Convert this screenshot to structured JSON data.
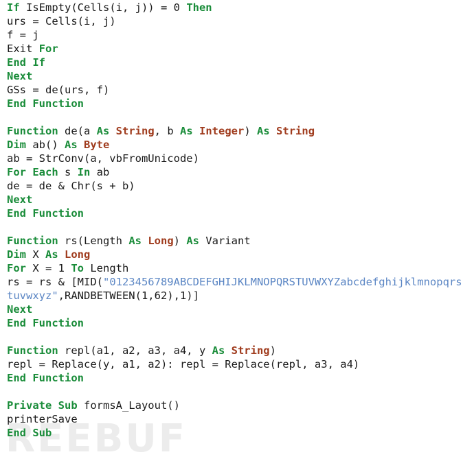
{
  "document": {
    "kind": "vba-source-code-listing",
    "background_color": "#ffffff",
    "watermark": {
      "text": "REEBUF",
      "color": "#ececec"
    },
    "syntax_colors": {
      "keyword": "#198c39",
      "type": "#a03c1e",
      "string": "#5b86c4",
      "plain": "#1a1a1a"
    }
  },
  "code": {
    "lines": [
      {
        "id": "line-1",
        "text": "If IsEmpty(Cells(i, j)) = 0 Then",
        "tokens": [
          {
            "t": "If",
            "c": "kw"
          },
          {
            "t": " IsEmpty(Cells(i, j)) = 0 ",
            "c": "pln"
          },
          {
            "t": "Then",
            "c": "kw"
          }
        ]
      },
      {
        "id": "line-2",
        "text": "urs = Cells(i, j)",
        "tokens": [
          {
            "t": "urs = Cells(i, j)",
            "c": "pln"
          }
        ]
      },
      {
        "id": "line-3",
        "text": "f = j",
        "tokens": [
          {
            "t": "f = j",
            "c": "pln"
          }
        ]
      },
      {
        "id": "line-4",
        "text": "Exit For",
        "tokens": [
          {
            "t": "Exit ",
            "c": "pln"
          },
          {
            "t": "For",
            "c": "kw"
          }
        ]
      },
      {
        "id": "line-5",
        "text": "End If",
        "tokens": [
          {
            "t": "End If",
            "c": "kw"
          }
        ]
      },
      {
        "id": "line-6",
        "text": "Next",
        "tokens": [
          {
            "t": "Next",
            "c": "kw"
          }
        ]
      },
      {
        "id": "line-7",
        "text": "GSs = de(urs, f)",
        "tokens": [
          {
            "t": "GSs = de(urs, f)",
            "c": "pln"
          }
        ]
      },
      {
        "id": "line-8",
        "text": "End Function",
        "tokens": [
          {
            "t": "End Function",
            "c": "kw"
          }
        ]
      },
      {
        "id": "line-9",
        "text": "",
        "tokens": []
      },
      {
        "id": "line-10",
        "text": "Function de(a As String, b As Integer) As String",
        "tokens": [
          {
            "t": "Function",
            "c": "kw"
          },
          {
            "t": " de(a ",
            "c": "pln"
          },
          {
            "t": "As",
            "c": "kw"
          },
          {
            "t": " ",
            "c": "pln"
          },
          {
            "t": "String",
            "c": "typ"
          },
          {
            "t": ", b ",
            "c": "pln"
          },
          {
            "t": "As",
            "c": "kw"
          },
          {
            "t": " ",
            "c": "pln"
          },
          {
            "t": "Integer",
            "c": "typ"
          },
          {
            "t": ") ",
            "c": "pln"
          },
          {
            "t": "As",
            "c": "kw"
          },
          {
            "t": " ",
            "c": "pln"
          },
          {
            "t": "String",
            "c": "typ"
          }
        ]
      },
      {
        "id": "line-11",
        "text": "Dim ab() As Byte",
        "tokens": [
          {
            "t": "Dim",
            "c": "kw"
          },
          {
            "t": " ab() ",
            "c": "pln"
          },
          {
            "t": "As",
            "c": "kw"
          },
          {
            "t": " ",
            "c": "pln"
          },
          {
            "t": "Byte",
            "c": "typ"
          }
        ]
      },
      {
        "id": "line-12",
        "text": "ab = StrConv(a, vbFromUnicode)",
        "tokens": [
          {
            "t": "ab = StrConv(a, vbFromUnicode)",
            "c": "pln"
          }
        ]
      },
      {
        "id": "line-13",
        "text": "For Each s In ab",
        "tokens": [
          {
            "t": "For Each",
            "c": "kw"
          },
          {
            "t": " s ",
            "c": "pln"
          },
          {
            "t": "In",
            "c": "kw"
          },
          {
            "t": " ab",
            "c": "pln"
          }
        ]
      },
      {
        "id": "line-14",
        "text": "de = de & Chr(s + b)",
        "tokens": [
          {
            "t": "de = de & Chr(s + b)",
            "c": "pln"
          }
        ]
      },
      {
        "id": "line-15",
        "text": "Next",
        "tokens": [
          {
            "t": "Next",
            "c": "kw"
          }
        ]
      },
      {
        "id": "line-16",
        "text": "End Function",
        "tokens": [
          {
            "t": "End Function",
            "c": "kw"
          }
        ]
      },
      {
        "id": "line-17",
        "text": "",
        "tokens": []
      },
      {
        "id": "line-18",
        "text": "Function rs(Length As Long) As Variant",
        "tokens": [
          {
            "t": "Function",
            "c": "kw"
          },
          {
            "t": " rs(Length ",
            "c": "pln"
          },
          {
            "t": "As",
            "c": "kw"
          },
          {
            "t": " ",
            "c": "pln"
          },
          {
            "t": "Long",
            "c": "typ"
          },
          {
            "t": ") ",
            "c": "pln"
          },
          {
            "t": "As",
            "c": "kw"
          },
          {
            "t": " Variant",
            "c": "pln"
          }
        ]
      },
      {
        "id": "line-19",
        "text": "Dim X As Long",
        "tokens": [
          {
            "t": "Dim",
            "c": "kw"
          },
          {
            "t": " X ",
            "c": "pln"
          },
          {
            "t": "As",
            "c": "kw"
          },
          {
            "t": " ",
            "c": "pln"
          },
          {
            "t": "Long",
            "c": "typ"
          }
        ]
      },
      {
        "id": "line-20",
        "text": "For X = 1 To Length",
        "tokens": [
          {
            "t": "For",
            "c": "kw"
          },
          {
            "t": " X = 1 ",
            "c": "pln"
          },
          {
            "t": "To",
            "c": "kw"
          },
          {
            "t": " Length",
            "c": "pln"
          }
        ]
      },
      {
        "id": "line-21",
        "text": "rs = rs & [MID(\"0123456789ABCDEFGHIJKLMNOPQRSTUVWXYZabcdefghijklmnopqrs",
        "tokens": [
          {
            "t": "rs = rs & [MID(",
            "c": "pln"
          },
          {
            "t": "\"0123456789ABCDEFGHIJKLMNOPQRSTUVWXYZabcdefghijklmnopqrs",
            "c": "str"
          }
        ]
      },
      {
        "id": "line-22",
        "text": "tuvwxyz\",RANDBETWEEN(1,62),1)]",
        "tokens": [
          {
            "t": "tuvwxyz\"",
            "c": "str"
          },
          {
            "t": ",RANDBETWEEN(1,62),1)]",
            "c": "pln"
          }
        ]
      },
      {
        "id": "line-23",
        "text": "Next",
        "tokens": [
          {
            "t": "Next",
            "c": "kw"
          }
        ]
      },
      {
        "id": "line-24",
        "text": "End Function",
        "tokens": [
          {
            "t": "End Function",
            "c": "kw"
          }
        ]
      },
      {
        "id": "line-25",
        "text": "",
        "tokens": []
      },
      {
        "id": "line-26",
        "text": "Function repl(a1, a2, a3, a4, y As String)",
        "tokens": [
          {
            "t": "Function",
            "c": "kw"
          },
          {
            "t": " repl(a1, a2, a3, a4, y ",
            "c": "pln"
          },
          {
            "t": "As",
            "c": "kw"
          },
          {
            "t": " ",
            "c": "pln"
          },
          {
            "t": "String",
            "c": "typ"
          },
          {
            "t": ")",
            "c": "pln"
          }
        ]
      },
      {
        "id": "line-27",
        "text": "repl = Replace(y, a1, a2): repl = Replace(repl, a3, a4)",
        "tokens": [
          {
            "t": "repl = Replace(y, a1, a2): repl = Replace(repl, a3, a4)",
            "c": "pln"
          }
        ]
      },
      {
        "id": "line-28",
        "text": "End Function",
        "tokens": [
          {
            "t": "End Function",
            "c": "kw"
          }
        ]
      },
      {
        "id": "line-29",
        "text": "",
        "tokens": []
      },
      {
        "id": "line-30",
        "text": "Private Sub formsA_Layout()",
        "tokens": [
          {
            "t": "Private Sub",
            "c": "kw"
          },
          {
            "t": " formsA_Layout()",
            "c": "pln"
          }
        ]
      },
      {
        "id": "line-31",
        "text": "printerSave",
        "tokens": [
          {
            "t": "printerSave",
            "c": "pln"
          }
        ]
      },
      {
        "id": "line-32",
        "text": "End Sub",
        "tokens": [
          {
            "t": "End Sub",
            "c": "kw"
          }
        ]
      }
    ]
  }
}
